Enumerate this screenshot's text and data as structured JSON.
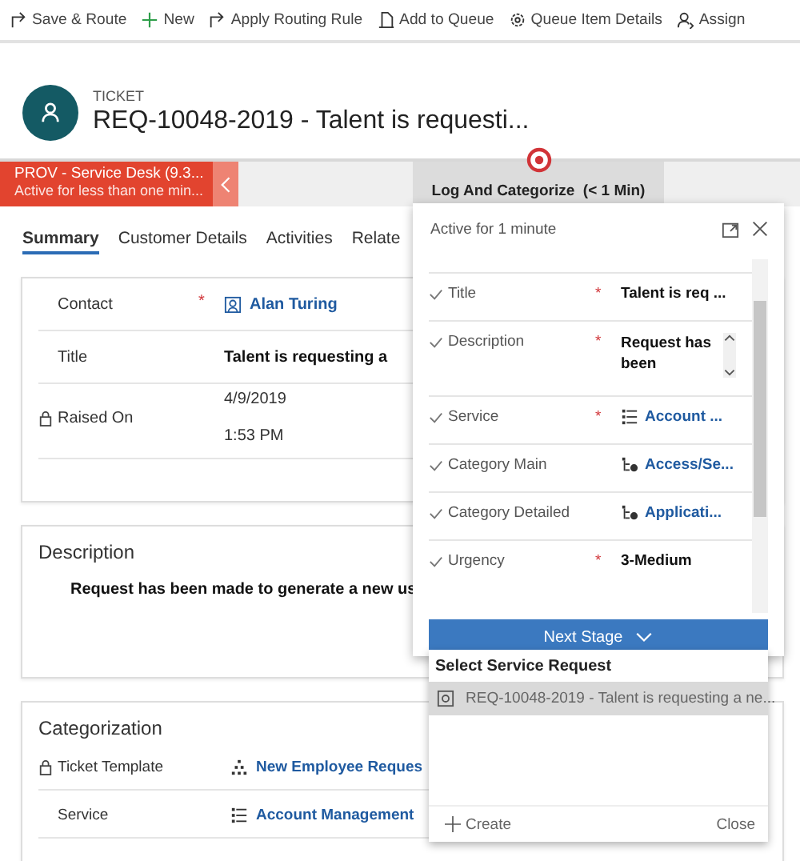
{
  "toolbar": [
    {
      "kind": "route",
      "label": "Save & Route"
    },
    {
      "kind": "add",
      "label": "New"
    },
    {
      "kind": "route",
      "label": "Apply Routing Rule"
    },
    {
      "kind": "queue",
      "label": "Add to Queue"
    },
    {
      "kind": "details",
      "label": "Queue Item Details"
    },
    {
      "kind": "assign",
      "label": "Assign"
    }
  ],
  "header": {
    "entity": "TICKET",
    "title": "REQ-10048-2019 - Talent is requesti..."
  },
  "process": {
    "active_stage": {
      "name": "PROV - Service Desk (9.3...",
      "duration": "Active for less than one min..."
    },
    "stage": {
      "name": "Log And Categorize",
      "duration": "(< 1 Min)"
    }
  },
  "tabs": [
    {
      "label": "Summary",
      "selected": true
    },
    {
      "label": "Customer Details",
      "selected": false
    },
    {
      "label": "Activities",
      "selected": false
    },
    {
      "label": "Relate",
      "selected": false
    }
  ],
  "summary_fields": [
    {
      "label": "Contact",
      "required_mark": "*",
      "locked": false,
      "kind": "contact",
      "values": [
        "Alan Turing"
      ]
    },
    {
      "label": "Title",
      "locked": false,
      "kind": "text",
      "values": [
        "Talent is requesting a"
      ]
    },
    {
      "label": "Raised On",
      "locked": true,
      "kind": "plain",
      "values": [
        "4/9/2019",
        "1:53 PM"
      ]
    }
  ],
  "description": {
    "heading": "Description",
    "text": "Request has been made to generate a new us"
  },
  "categorization": {
    "heading": "Categorization",
    "fields": [
      {
        "label": "Ticket Template",
        "locked": true,
        "kind": "template",
        "value": "New Employee Reques"
      },
      {
        "label": "Service",
        "locked": false,
        "kind": "service",
        "value": "Account Management"
      }
    ]
  },
  "stage_flyout": {
    "status": "Active for 1 minute",
    "fields": [
      {
        "label": "Title",
        "required_mark": "*",
        "kind": "text",
        "value": "Talent is req ..."
      },
      {
        "label": "Description",
        "required_mark": "*",
        "kind": "note",
        "value": "Request has been"
      },
      {
        "label": "Service",
        "required_mark": "*",
        "kind": "service",
        "value": "Account ..."
      },
      {
        "label": "Category Main",
        "kind": "category",
        "value": "Access/Se..."
      },
      {
        "label": "Category Detailed",
        "kind": "category",
        "value": "Applicati..."
      },
      {
        "label": "Urgency",
        "required_mark": "*",
        "kind": "text",
        "value": "3-Medium"
      }
    ],
    "next_button": "Next Stage"
  },
  "lookup": {
    "title": "Select Service Request",
    "results": [
      {
        "label": "REQ-10048-2019 - Talent is requesting a ne...",
        "selected": true
      }
    ],
    "create": "Create",
    "close": "Close"
  }
}
